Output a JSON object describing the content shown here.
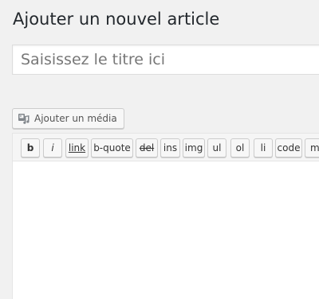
{
  "page": {
    "title": "Ajouter un nouvel article"
  },
  "title_field": {
    "placeholder": "Saisissez le titre ici",
    "value": ""
  },
  "media": {
    "label": "Ajouter un média"
  },
  "toolbar": {
    "buttons": [
      "b",
      "i",
      "link",
      "b-quote",
      "del",
      "ins",
      "img",
      "ul",
      "ol",
      "li",
      "code",
      "more"
    ]
  },
  "editor": {
    "content": ""
  }
}
